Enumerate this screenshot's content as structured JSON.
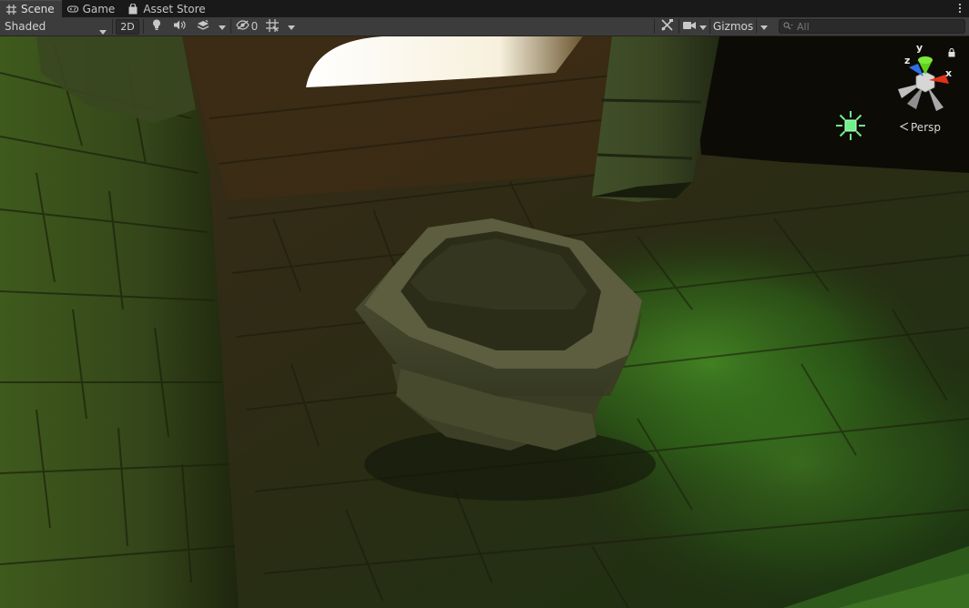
{
  "tabs": [
    {
      "label": "Scene",
      "icon": "grid-icon",
      "active": true
    },
    {
      "label": "Game",
      "icon": "gamepad-icon",
      "active": false
    },
    {
      "label": "Asset Store",
      "icon": "shopping-bag-icon",
      "active": false
    }
  ],
  "toolbar": {
    "shading_mode": "Shaded",
    "toggle_2d": "2D",
    "hidden_count": "0",
    "gizmos_label": "Gizmos",
    "search_placeholder": "All"
  },
  "viewport": {
    "projection_label": "Persp",
    "axis_x": "x",
    "axis_y": "y",
    "axis_z": "z"
  },
  "colors": {
    "axis_x": "#e0321a",
    "axis_y": "#5ed11a",
    "axis_z": "#2f6fe5",
    "light_gizmo": "#6df28a"
  }
}
